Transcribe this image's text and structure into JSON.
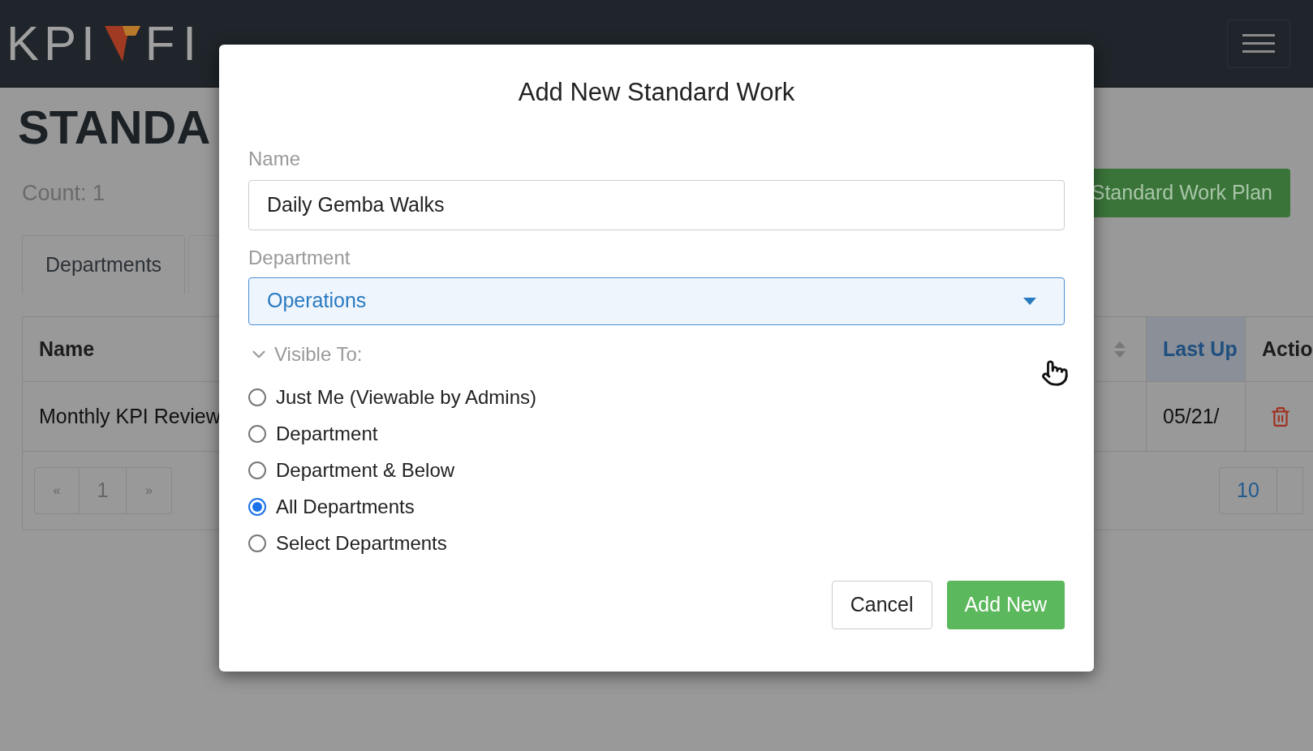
{
  "header": {
    "logo_left": "KPI",
    "logo_right": "FI"
  },
  "page": {
    "title": "STANDA",
    "count": "Count: 1",
    "add_button": "Standard Work Plan",
    "tabs": [
      {
        "label": "Departments",
        "selected": true
      },
      {
        "selected": false
      }
    ],
    "table": {
      "columns": [
        {
          "label": "Name",
          "sorted": false
        },
        {
          "label": "Last Up",
          "sorted": true
        },
        {
          "label": "Actio",
          "sorted": false
        }
      ],
      "rows": [
        {
          "name": "Monthly KPI Review",
          "last_updated": "05/21/"
        }
      ]
    },
    "pagination": {
      "prev": "«",
      "pages": [
        {
          "label": "1",
          "selected": false
        }
      ],
      "next": "»"
    },
    "page_size": "10"
  },
  "modal": {
    "title": "Add New Standard Work",
    "name_field": {
      "label": "Name",
      "value": "Daily Gemba Walks"
    },
    "department_field": {
      "label": "Department",
      "value": "Operations"
    },
    "visible_to": {
      "label": "Visible To:",
      "expanded": true,
      "options": [
        {
          "label": "Just Me (Viewable by Admins)",
          "selected": false
        },
        {
          "label": "Department",
          "selected": false
        },
        {
          "label": "Department & Below",
          "selected": false
        },
        {
          "label": "All Departments",
          "selected": true
        },
        {
          "label": "Select Departments",
          "selected": false
        }
      ]
    },
    "buttons": {
      "cancel": "Cancel",
      "submit": "Add New"
    }
  }
}
